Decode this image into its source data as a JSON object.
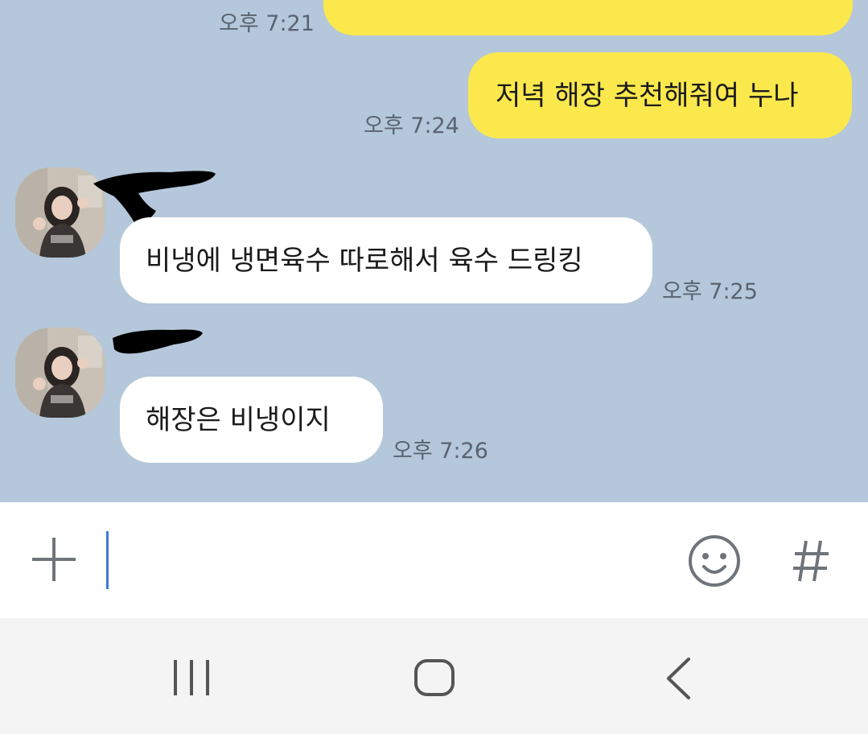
{
  "messages": [
    {
      "id": "m1",
      "sender": "me",
      "text": "",
      "time": "오후 7:21"
    },
    {
      "id": "m2",
      "sender": "me",
      "text": "저녁 해장 추천해줘여 누나",
      "time": "오후 7:24"
    },
    {
      "id": "m3",
      "sender": "other",
      "name": "",
      "text": "비냉에 냉면육수 따로해서 육수 드링킹",
      "time": "오후 7:25"
    },
    {
      "id": "m4",
      "sender": "other",
      "name": "",
      "text": "해장은 비냉이지",
      "time": "오후 7:26"
    }
  ],
  "input": {
    "value": "",
    "placeholder": ""
  },
  "icons": {
    "add": "plus-icon",
    "emoji": "emoticon-icon",
    "hashtag": "hashtag-icon",
    "recents": "recent-apps-icon",
    "home": "home-icon",
    "back": "back-icon"
  },
  "colors": {
    "chat_background": "#b5c7da",
    "my_bubble": "#fbe84d",
    "other_bubble": "#ffffff",
    "cursor": "#3b7bd6"
  }
}
